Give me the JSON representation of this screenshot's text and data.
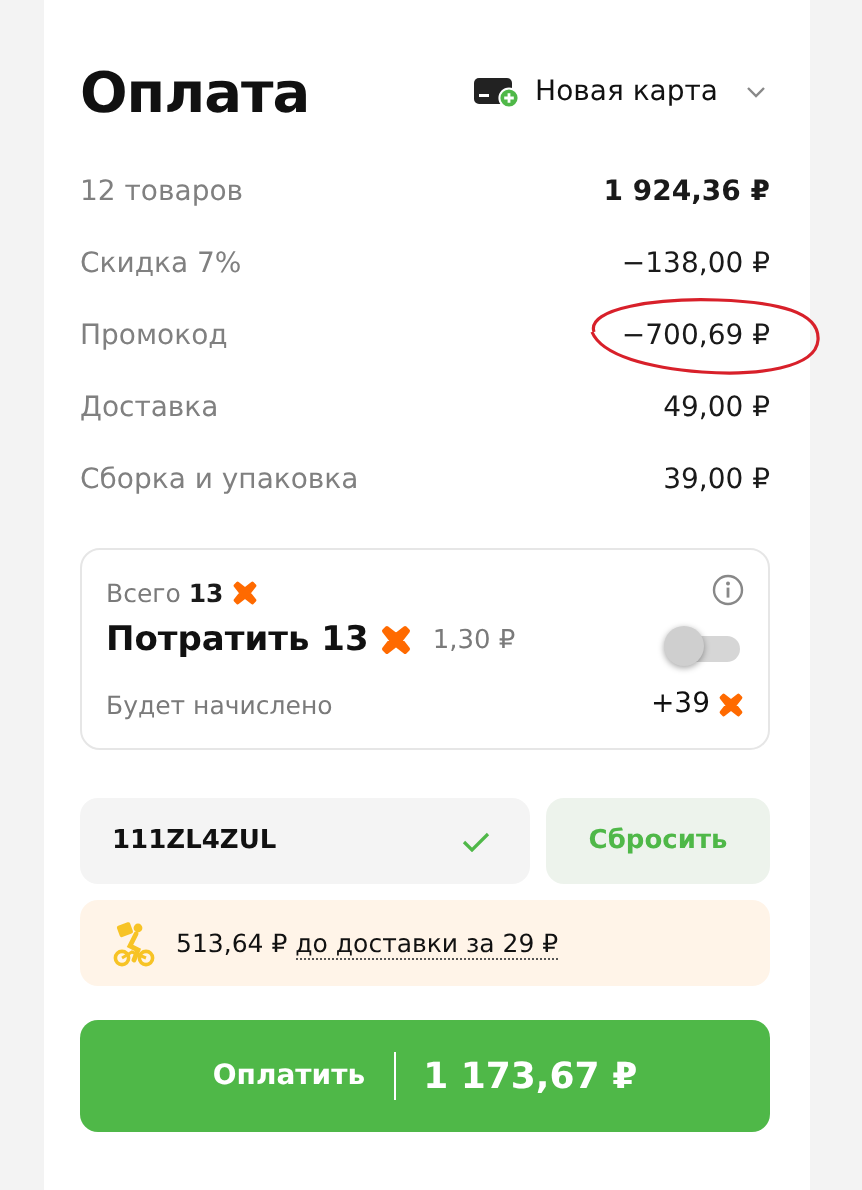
{
  "title": "Оплата",
  "payment_method": {
    "label": "Новая карта"
  },
  "summary": [
    {
      "label": "12 товаров",
      "value": "1 924,36 ₽",
      "bold": true,
      "circled": false
    },
    {
      "label": "Скидка 7%",
      "value": "−138,00 ₽",
      "bold": false,
      "circled": false
    },
    {
      "label": "Промокод",
      "value": "−700,69 ₽",
      "bold": false,
      "circled": true
    },
    {
      "label": "Доставка",
      "value": "49,00 ₽",
      "bold": false,
      "circled": false
    },
    {
      "label": "Сборка и упаковка",
      "value": "39,00 ₽",
      "bold": false,
      "circled": false
    }
  ],
  "bonus": {
    "total_label": "Всего",
    "total": "13",
    "spend_label": "Потратить 13",
    "spend_value": "1,30 ₽",
    "on": false,
    "accrual_label": "Будет начислено",
    "accrual": "+39"
  },
  "promo": {
    "value": "111ZL4ZUL",
    "valid": true,
    "reset": "Сбросить"
  },
  "delivery_hint": {
    "amount": "513,64 ₽",
    "link": "до доставки за 29 ₽"
  },
  "pay": {
    "label": "Оплатить",
    "total": "1 173,67 ₽"
  }
}
